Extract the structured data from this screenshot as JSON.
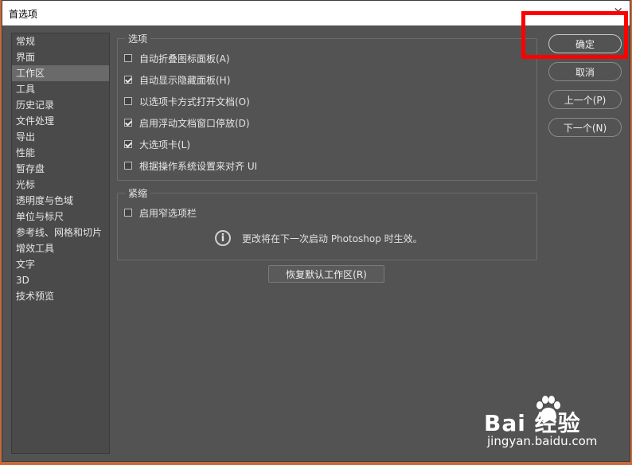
{
  "window": {
    "title": "首选项",
    "close_glyph": "×"
  },
  "sidebar": {
    "items": [
      "常规",
      "界面",
      "工作区",
      "工具",
      "历史记录",
      "文件处理",
      "导出",
      "性能",
      "暂存盘",
      "光标",
      "透明度与色域",
      "单位与标尺",
      "参考线、网格和切片",
      "增效工具",
      "文字",
      "3D",
      "技术预览"
    ],
    "selected_index": 2
  },
  "options_group": {
    "legend": "选项",
    "items": [
      {
        "label": "自动折叠图标面板(A)",
        "checked": false
      },
      {
        "label": "自动显示隐藏面板(H)",
        "checked": true
      },
      {
        "label": "以选项卡方式打开文档(O)",
        "checked": false
      },
      {
        "label": "启用浮动文档窗口停放(D)",
        "checked": true
      },
      {
        "label": "大选项卡(L)",
        "checked": true
      },
      {
        "label": "根据操作系统设置来对齐 UI",
        "checked": false
      }
    ]
  },
  "compact_group": {
    "legend": "紧缩",
    "items": [
      {
        "label": "启用窄选项栏",
        "checked": false
      }
    ],
    "info_text": "更改将在下一次启动 Photoshop 时生效。"
  },
  "restore_button": "恢复默认工作区(R)",
  "buttons": {
    "ok": "确定",
    "cancel": "取消",
    "prev": "上一个(P)",
    "next": "下一个(N)"
  },
  "watermark": {
    "brand": "Bai 经验",
    "url": "jingyan.baidu.com"
  },
  "icons": {
    "info": "info-icon",
    "close": "close-icon",
    "check": "checkmark-icon"
  },
  "colors": {
    "dialog_bg": "#535353",
    "panel_bg": "#4a4a4a",
    "selected_bg": "#6a6a6a",
    "highlight": "#ff0000",
    "title_bar": "#ffffff"
  }
}
